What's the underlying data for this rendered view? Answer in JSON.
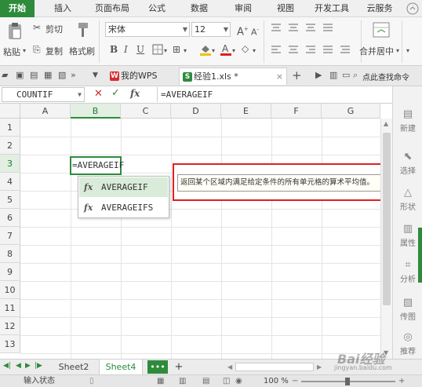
{
  "menu": {
    "tabs": [
      "开始",
      "插入",
      "页面布局",
      "公式",
      "数据",
      "审阅",
      "视图",
      "开发工具",
      "云服务"
    ]
  },
  "ribbon": {
    "paste": "粘贴",
    "cut": "剪切",
    "copy": "复制",
    "format_painter": "格式刷",
    "font_name": "宋体",
    "font_size": "12",
    "merge_center": "合并居中"
  },
  "docbar": {
    "tab_mywps": "我的WPS",
    "tab_file": "经验1.xls *",
    "search": "点此查找命令"
  },
  "formula_bar": {
    "name_box": "COUNTIF",
    "fx": "fx",
    "formula": "=AVERAGEIF"
  },
  "grid": {
    "columns": [
      "A",
      "B",
      "C",
      "D",
      "E",
      "F",
      "G"
    ],
    "rows": [
      "1",
      "2",
      "3",
      "4",
      "5",
      "6",
      "7",
      "8",
      "9",
      "10",
      "11",
      "12",
      "13"
    ],
    "active_cell_text": "=AVERAGEIF"
  },
  "autocomplete": {
    "items": [
      "AVERAGEIF",
      "AVERAGEIFS"
    ]
  },
  "tooltip": {
    "text": "返回某个区域内满足给定条件的所有单元格的算术平均值。"
  },
  "right_panel": {
    "items": [
      "新建",
      "选择",
      "形状",
      "属性",
      "分析",
      "传图",
      "推荐"
    ]
  },
  "sheets": {
    "tabs": [
      "Sheet2",
      "Sheet4"
    ]
  },
  "status": {
    "mode": "输入状态",
    "zoom": "100 %"
  },
  "watermark": {
    "text": "Bai经验",
    "url": "jingyan.baidu.com"
  },
  "colors": {
    "accent": "#2e8b3b",
    "highlight_border": "#e02020"
  }
}
